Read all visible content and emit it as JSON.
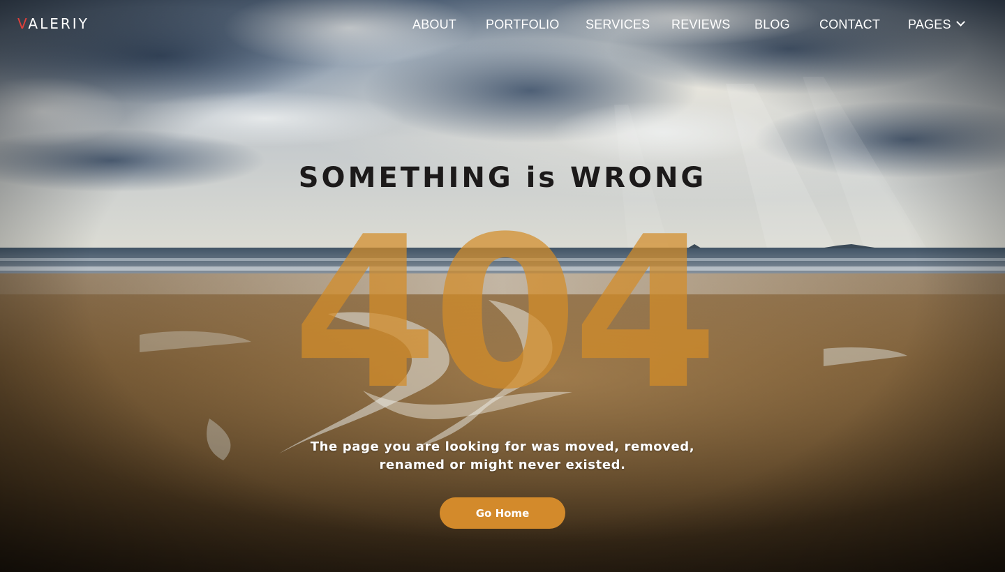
{
  "brand": {
    "logo_accent": "V",
    "logo_rest": "ALERIY"
  },
  "nav": {
    "items": [
      {
        "label": "ABOUT"
      },
      {
        "label": "PORTFOLIO"
      },
      {
        "label": "SERVICES"
      },
      {
        "label": "REVIEWS"
      },
      {
        "label": "BLOG"
      },
      {
        "label": "CONTACT"
      },
      {
        "label": "PAGES"
      }
    ],
    "pages_icon": "chevron-down-icon"
  },
  "error": {
    "headline": "SOMETHING is WRONG",
    "code": "404",
    "message_line1": "The page you are looking for was moved, removed,",
    "message_line2": "renamed or might never existed.",
    "button_label": "Go Home"
  },
  "colors": {
    "accent": "#d38a2b",
    "logo_accent": "#e0403a",
    "headline": "#1c1a1a",
    "nav_text": "#ffffff"
  }
}
